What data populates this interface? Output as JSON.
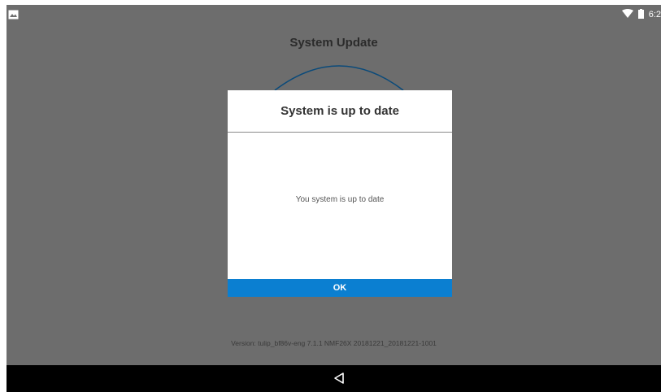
{
  "status_bar": {
    "left_icon": "image-icon",
    "wifi_icon": "wifi-icon",
    "battery_icon": "battery-icon",
    "time": "6:2"
  },
  "page": {
    "title": "System Update",
    "version_text": "Version: tulip_bf86v-eng 7.1.1 NMF26X 20181221_20181221-1001"
  },
  "dialog": {
    "title": "System is up to date",
    "message": "You system is up to date",
    "ok_label": "OK"
  },
  "nav_bar": {
    "back_icon": "back-triangle-icon"
  },
  "colors": {
    "accent": "#0b7fd1",
    "scrim_background": "#6d6d6d",
    "arc": "#0a4a7a"
  }
}
